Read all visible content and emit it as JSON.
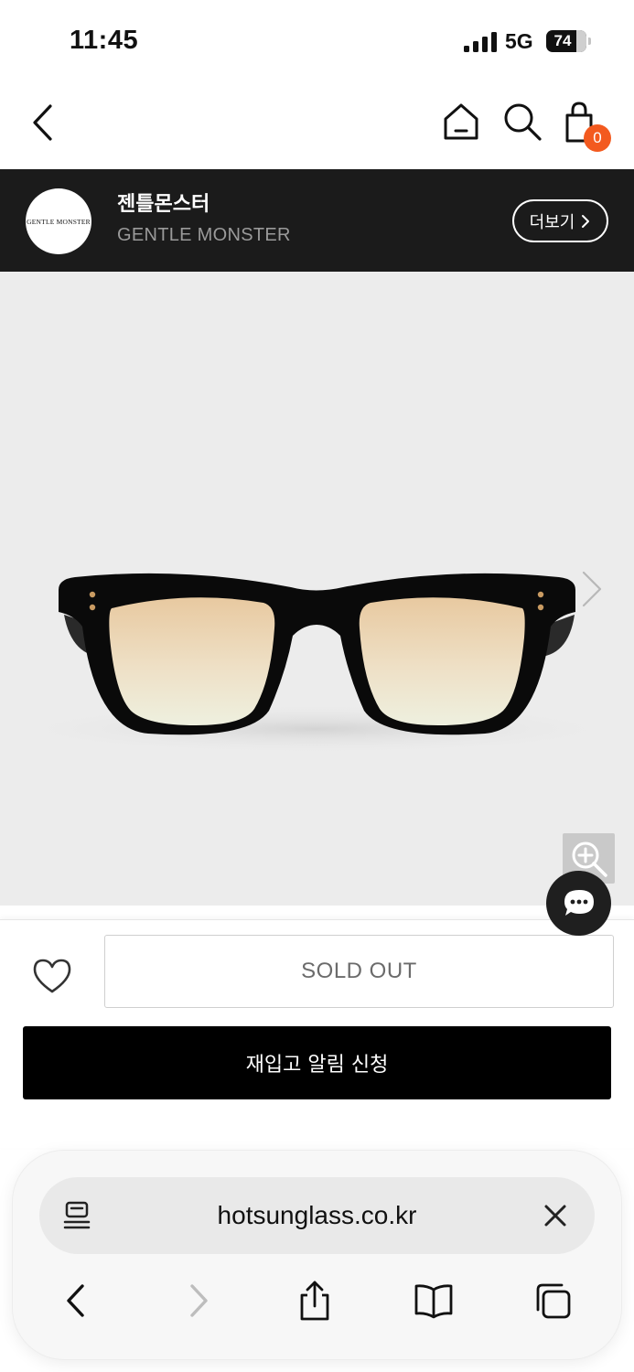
{
  "status_bar": {
    "time": "11:45",
    "network": "5G",
    "battery": "74"
  },
  "header": {
    "back_icon": "chevron-left-icon",
    "home_icon": "home-icon",
    "search_icon": "search-icon",
    "cart_icon": "shopping-bag-icon",
    "cart_count": "0"
  },
  "brand": {
    "logo_text": "GENTLE MONSTER",
    "name_ko": "젠틀몬스터",
    "name_en": "GENTLE MONSTER",
    "more_label": "더보기"
  },
  "product": {
    "image_icon": "sunglasses-image",
    "next_icon": "chevron-right-icon",
    "zoom_icon": "zoom-in-icon",
    "chat_icon": "chat-bubble-icon"
  },
  "purchase": {
    "wishlist_icon": "heart-icon",
    "sold_out_label": "SOLD OUT",
    "restock_label": "재입고 알림 신청"
  },
  "browser": {
    "url": "hotsunglass.co.kr",
    "reader_icon": "page-menu-icon",
    "close_icon": "close-icon",
    "nav": [
      "back-icon",
      "forward-icon",
      "share-icon",
      "bookmarks-icon",
      "tabs-icon"
    ]
  },
  "colors": {
    "brand_bar": "#1b1b1b",
    "badge": "#f35a1f",
    "primary_button": "#000000",
    "image_bg": "#ececec"
  }
}
